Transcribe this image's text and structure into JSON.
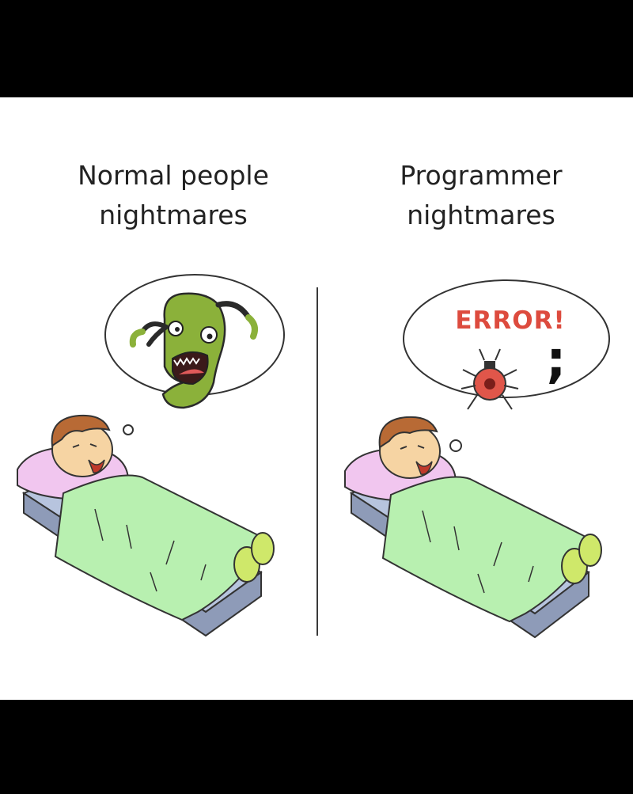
{
  "panels": {
    "left": {
      "caption_line1": "Normal people",
      "caption_line2": "nightmares"
    },
    "right": {
      "caption_line1": "Programmer",
      "caption_line2": "nightmares",
      "error_text": "ERROR!",
      "symbol": ";"
    }
  },
  "colors": {
    "background": "#ffffff",
    "frame": "#000000",
    "error": "#dd4b3e",
    "monster": "#8bb13a",
    "blanket": "#b8f0b0",
    "pillow": "#f1c6ef",
    "mattress": "#b7c4de",
    "hair": "#b86a35",
    "skin": "#f6d4a3"
  }
}
